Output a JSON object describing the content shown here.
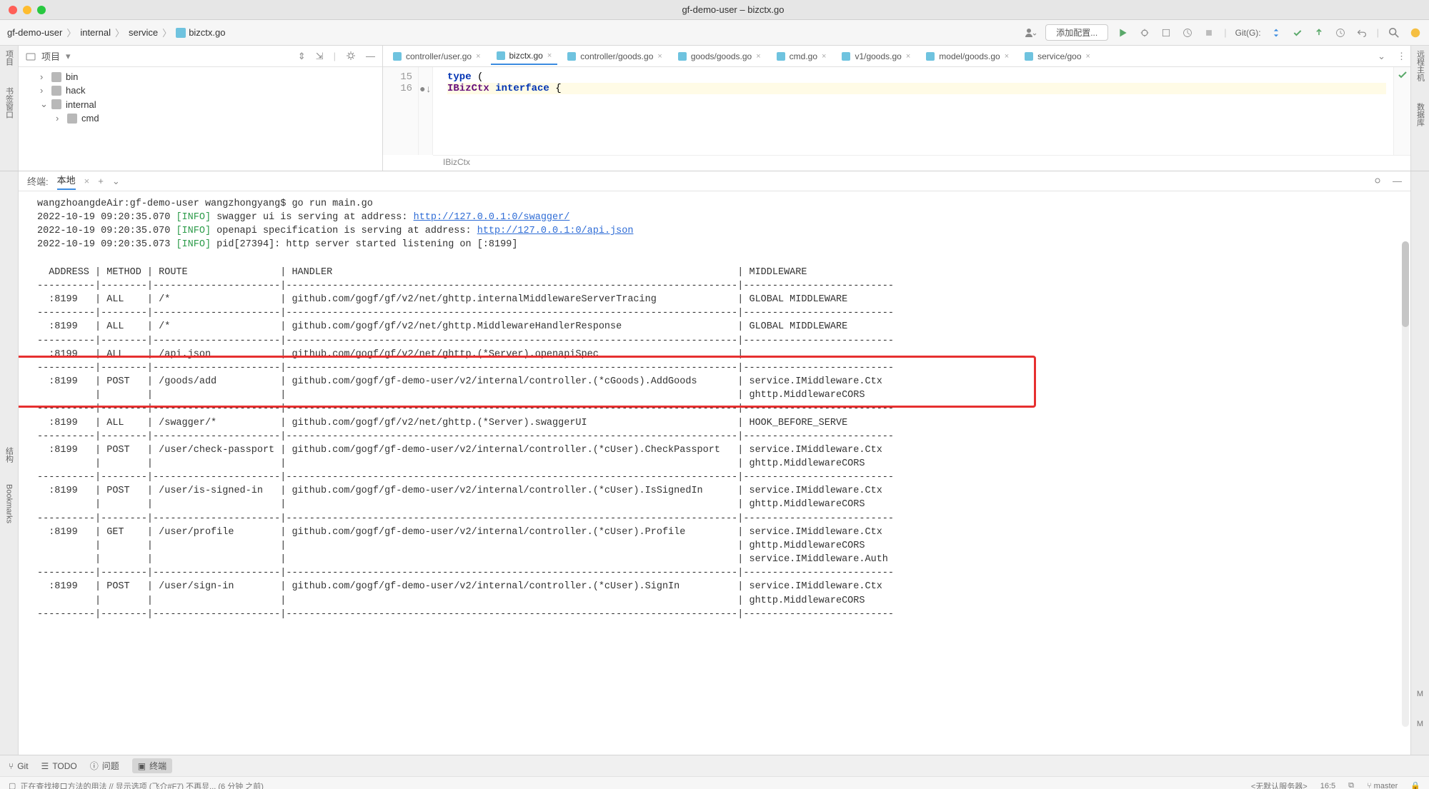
{
  "title": "gf-demo-user – bizctx.go",
  "breadcrumbs": [
    "gf-demo-user",
    "internal",
    "service",
    "bizctx.go"
  ],
  "run_config": "添加配置...",
  "git_label": "Git(G):",
  "project": {
    "header": "项目",
    "tree": [
      {
        "indent": 1,
        "caret": "›",
        "label": "bin"
      },
      {
        "indent": 1,
        "caret": "›",
        "label": "hack"
      },
      {
        "indent": 1,
        "caret": "⌄",
        "label": "internal"
      },
      {
        "indent": 2,
        "caret": "›",
        "label": "cmd"
      }
    ]
  },
  "tabs": [
    {
      "label": "controller/user.go",
      "icon": "go"
    },
    {
      "label": "bizctx.go",
      "icon": "go",
      "active": true
    },
    {
      "label": "controller/goods.go",
      "icon": "go"
    },
    {
      "label": "goods/goods.go",
      "icon": "go"
    },
    {
      "label": "cmd.go",
      "icon": "go"
    },
    {
      "label": "v1/goods.go",
      "icon": "go"
    },
    {
      "label": "model/goods.go",
      "icon": "go"
    },
    {
      "label": "service/goo",
      "icon": "go"
    }
  ],
  "editor": {
    "lines": [
      {
        "n": 15,
        "html": "<span class='kw'>type</span> ("
      },
      {
        "n": 16,
        "html": "    <span class='id'>IBizCtx</span> <span class='kw'>interface</span> {",
        "hl": true
      }
    ],
    "crumb": "IBizCtx"
  },
  "terminal": {
    "title": "终端:",
    "tab": "本地",
    "log_pre": "wangzhoangdeAir:gf-demo-user wangzhongyang$ go run main.go",
    "log_lines": [
      {
        "ts": "2022-10-19 09:20:35.070",
        "lvl": "[INFO]",
        "msg": "swagger ui is serving at address: ",
        "link": "http://127.0.0.1:0/swagger/"
      },
      {
        "ts": "2022-10-19 09:20:35.070",
        "lvl": "[INFO]",
        "msg": "openapi specification is serving at address: ",
        "link": "http://127.0.0.1:0/api.json"
      },
      {
        "ts": "2022-10-19 09:20:35.073",
        "lvl": "[INFO]",
        "msg": "pid[27394]: http server started listening on [:8199]"
      }
    ],
    "table_header": {
      "address": "ADDRESS",
      "method": "METHOD",
      "route": "ROUTE",
      "handler": "HANDLER",
      "middleware": "MIDDLEWARE"
    },
    "rows": [
      {
        "address": ":8199",
        "method": "ALL",
        "route": "/*",
        "handler": "github.com/gogf/gf/v2/net/ghttp.internalMiddlewareServerTracing",
        "middleware": [
          "GLOBAL MIDDLEWARE"
        ]
      },
      {
        "address": ":8199",
        "method": "ALL",
        "route": "/*",
        "handler": "github.com/gogf/gf/v2/net/ghttp.MiddlewareHandlerResponse",
        "middleware": [
          "GLOBAL MIDDLEWARE"
        ]
      },
      {
        "address": ":8199",
        "method": "ALL",
        "route": "/api.json",
        "handler": "github.com/gogf/gf/v2/net/ghttp.(*Server).openapiSpec",
        "middleware": [
          ""
        ]
      },
      {
        "address": ":8199",
        "method": "POST",
        "route": "/goods/add",
        "handler": "github.com/gogf/gf-demo-user/v2/internal/controller.(*cGoods).AddGoods",
        "middleware": [
          "service.IMiddleware.Ctx",
          "ghttp.MiddlewareCORS"
        ],
        "highlight": true
      },
      {
        "address": ":8199",
        "method": "ALL",
        "route": "/swagger/*",
        "handler": "github.com/gogf/gf/v2/net/ghttp.(*Server).swaggerUI",
        "middleware": [
          "HOOK_BEFORE_SERVE"
        ]
      },
      {
        "address": ":8199",
        "method": "POST",
        "route": "/user/check-passport",
        "handler": "github.com/gogf/gf-demo-user/v2/internal/controller.(*cUser).CheckPassport",
        "middleware": [
          "service.IMiddleware.Ctx",
          "ghttp.MiddlewareCORS"
        ]
      },
      {
        "address": ":8199",
        "method": "POST",
        "route": "/user/is-signed-in",
        "handler": "github.com/gogf/gf-demo-user/v2/internal/controller.(*cUser).IsSignedIn",
        "middleware": [
          "service.IMiddleware.Ctx",
          "ghttp.MiddlewareCORS"
        ]
      },
      {
        "address": ":8199",
        "method": "GET",
        "route": "/user/profile",
        "handler": "github.com/gogf/gf-demo-user/v2/internal/controller.(*cUser).Profile",
        "middleware": [
          "service.IMiddleware.Ctx",
          "ghttp.MiddlewareCORS",
          "service.IMiddleware.Auth"
        ]
      },
      {
        "address": ":8199",
        "method": "POST",
        "route": "/user/sign-in",
        "handler": "github.com/gogf/gf-demo-user/v2/internal/controller.(*cUser).SignIn",
        "middleware": [
          "service.IMiddleware.Ctx",
          "ghttp.MiddlewareCORS"
        ]
      }
    ]
  },
  "bottombar": {
    "git": "Git",
    "todo": "TODO",
    "problems": "问题",
    "terminal": "终端"
  },
  "statusbar": {
    "left": "正在查找接口方法的用法 // 显示选项 (飞介#F7)  不再显... (6 分钟 之前)",
    "server": "<无默认服务器>",
    "pos": "16:5",
    "branch": "master"
  },
  "left_sidebar": {
    "project": "项目",
    "bookmark": "书签窗口",
    "structure": "结构",
    "bookmarks": "Bookmarks"
  },
  "right_sidebar": {
    "remote": "远程主机",
    "database": "数据库"
  }
}
